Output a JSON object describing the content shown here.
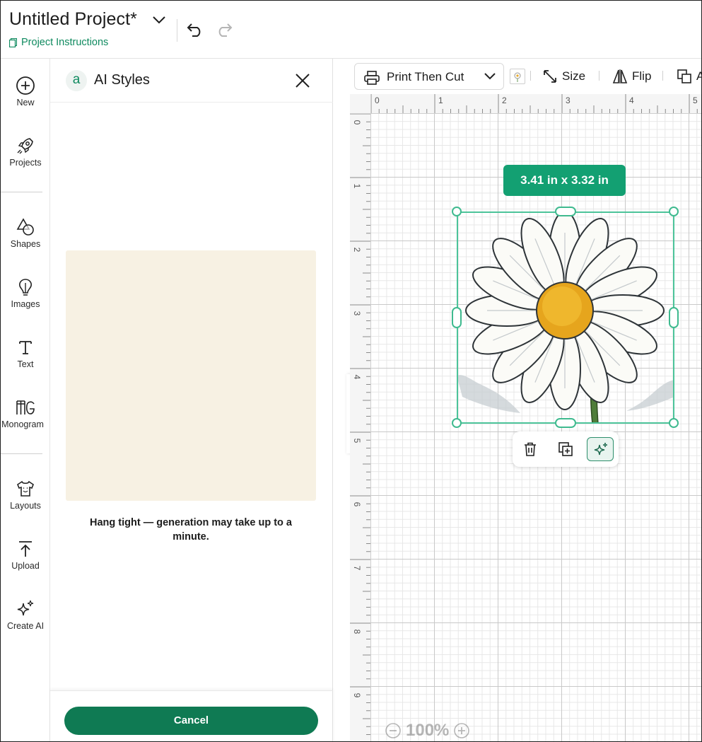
{
  "header": {
    "project_title": "Untitled Project*",
    "project_instructions": "Project Instructions"
  },
  "left_rail": {
    "items": [
      {
        "label": "New",
        "icon": "plus-circle-icon"
      },
      {
        "label": "Projects",
        "icon": "rocket-icon"
      },
      {
        "label": "Shapes",
        "icon": "shapes-icon"
      },
      {
        "label": "Images",
        "icon": "lightbulb-icon"
      },
      {
        "label": "Text",
        "icon": "text-icon"
      },
      {
        "label": "Monogram",
        "icon": "monogram-icon"
      },
      {
        "label": "Layouts",
        "icon": "tshirt-icon"
      },
      {
        "label": "Upload",
        "icon": "upload-icon"
      },
      {
        "label": "Create AI",
        "icon": "sparkle-icon"
      }
    ]
  },
  "ai_panel": {
    "title": "AI Styles",
    "logo_glyph": "a",
    "status_message": "Hang tight — generation may take up to a minute.",
    "cancel_label": "Cancel",
    "preview_color": "#f7f1e3"
  },
  "toolbar": {
    "operation": "Print Then Cut",
    "size_label": "Size",
    "flip_label": "Flip",
    "arrange_label": "A"
  },
  "canvas": {
    "ruler_top": [
      "0",
      "1",
      "2",
      "3",
      "4",
      "5"
    ],
    "ruler_left": [
      "0",
      "1",
      "2",
      "3",
      "4",
      "5",
      "6",
      "7",
      "8",
      "9"
    ],
    "dimensions": "3.41  in x 3.32  in",
    "zoom": "100%"
  },
  "colors": {
    "brand_green": "#0f7a53",
    "selection_green": "#4cc49a",
    "badge_green": "#13a072"
  }
}
